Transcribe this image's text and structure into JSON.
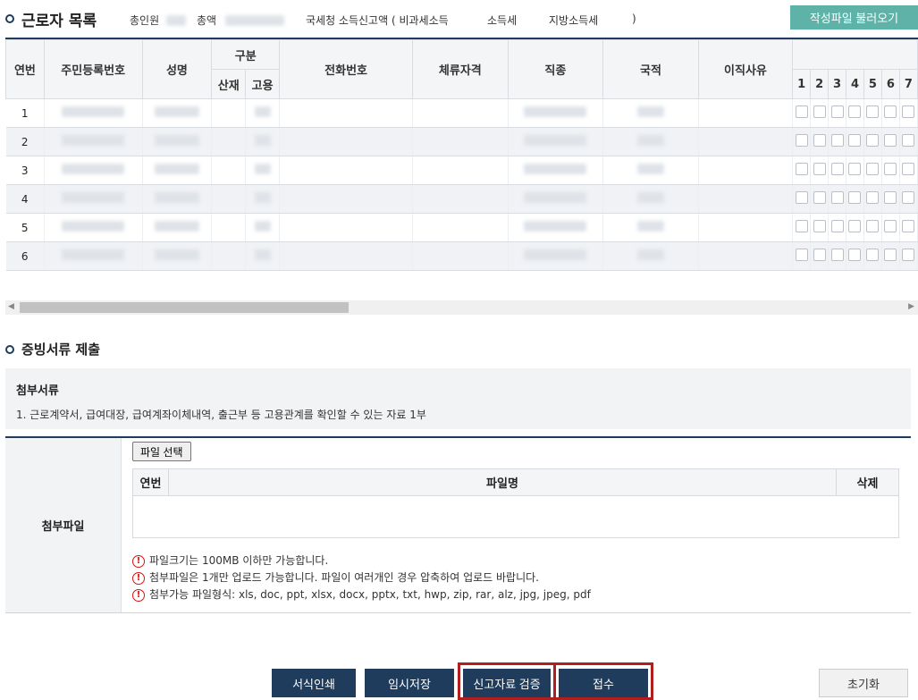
{
  "header": {
    "title": "근로자 목록",
    "total_label": "총인원",
    "amount_label": "총액",
    "nts_label": "국세청 소득신고액 ( 비과세소득",
    "income_tax_label": "소득세",
    "local_tax_label": "지방소득세",
    "close_paren": ")",
    "load_button": "작성파일 불러오기"
  },
  "table": {
    "headers": {
      "no": "연번",
      "rrn": "주민등록번호",
      "name": "성명",
      "category": "구분",
      "cat_injury": "산재",
      "cat_employ": "고용",
      "phone": "전화번호",
      "visa": "체류자격",
      "job": "직종",
      "nationality": "국적",
      "leave_reason": "이직사유"
    },
    "day_numbers": [
      "1",
      "2",
      "3",
      "4",
      "5",
      "6",
      "7"
    ],
    "rows": [
      "1",
      "2",
      "3",
      "4",
      "5",
      "6"
    ]
  },
  "evidence": {
    "title": "증빙서류 제출",
    "doc_heading": "첨부서류",
    "doc_desc": "1. 근로계약서, 급여대장, 급여계좌이체내역, 출근부 등 고용관계를 확인할 수 있는 자료 1부",
    "attach_label": "첨부파일",
    "file_select": "파일 선택",
    "col_no": "연번",
    "col_filename": "파일명",
    "col_delete": "삭제",
    "notes": [
      "파일크기는 100MB 이하만 가능합니다.",
      "첨부파일은 1개만 업로드 가능합니다. 파일이 여러개인 경우 압축하여 업로드 바랍니다.",
      "첨부가능 파일형식: xls, doc, ppt, xlsx, docx, pptx, txt, hwp, zip, rar, alz, jpg, jpeg, pdf"
    ],
    "warn_symbol": "!"
  },
  "buttons": {
    "print": "서식인쇄",
    "temp_save": "임시저장",
    "verify": "신고자료 검증",
    "submit": "접수",
    "reset": "초기화"
  },
  "colors": {
    "navy": "#1f3c5c",
    "teal": "#5fb2a8",
    "highlight": "#b01e1e"
  }
}
